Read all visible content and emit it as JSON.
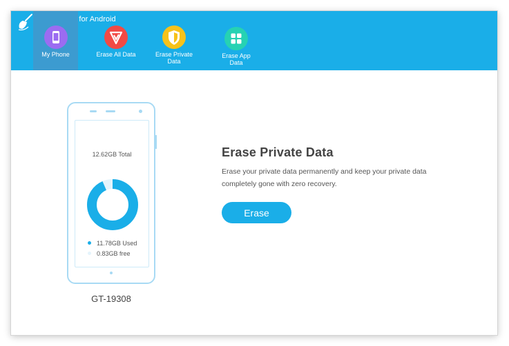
{
  "app": {
    "title": "SafeWiper for Android"
  },
  "nav": {
    "items": [
      {
        "label": "My Phone",
        "icon": "phone-icon",
        "color": "#9b6cf1",
        "active": true
      },
      {
        "label": "Erase All Data",
        "icon": "erase-all-icon",
        "color": "#f14a45",
        "active": false
      },
      {
        "label_line1": "Erase Private",
        "label_line2": "Data",
        "icon": "shield-icon",
        "color": "#f7c21a",
        "active": false
      },
      {
        "label_line1": "Erase App",
        "label_line2": "Data",
        "icon": "apps-grid-icon",
        "color": "#26d2b3",
        "active": false
      }
    ]
  },
  "device": {
    "total": "12.62GB Total",
    "used": "11.78GB Used",
    "free": "0.83GB free",
    "used_fraction": 0.934,
    "name": "GT-19308"
  },
  "main": {
    "heading": "Erase Private Data",
    "desc_line1": "Erase your private data permanently and keep your private data",
    "desc_line2": "completely gone with zero recovery.",
    "erase_label": "Erase"
  },
  "colors": {
    "accent": "#1aaee8",
    "used": "#1aaee8",
    "free": "#e4f4fc"
  }
}
